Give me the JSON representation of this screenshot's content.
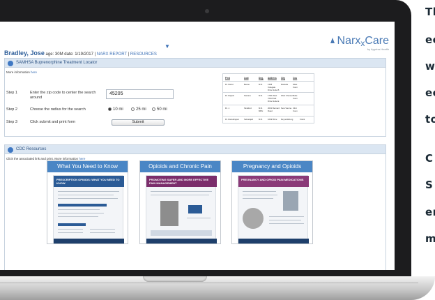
{
  "header": {
    "brand_pre": "Narx",
    "brand_sub": "Care",
    "brand_tagline": "by Appriss Health",
    "patient_name": "Bradley, Jose",
    "age_label": "age: 30M",
    "date_label": "date: 1/19/2017",
    "separator": "|",
    "narx_report_link": "NARX REPORT",
    "resources_link": "RESOURCES"
  },
  "samhsa": {
    "title": "SAMHSA Buprenorphine Treatment Locator",
    "more_info_prefix": "More information",
    "more_info_link": "here",
    "step1_label": "Step 1",
    "step1_text": "Enter the zip code to center the search around",
    "zip_value": "45205",
    "step2_label": "Step 2",
    "step2_text": "Choose the radius for the search",
    "radius_options": [
      "10 mi",
      "25 mi",
      "50 mi"
    ],
    "radius_selected": "10 mi",
    "step3_label": "Step 3",
    "step3_text": "Click submit and print form",
    "submit_label": "Submit"
  },
  "locator_table": {
    "headers": [
      "First",
      "Last",
      "Deg.",
      "Address",
      "City",
      "Cou"
    ],
    "rows": [
      [
        "Dr. David",
        "Beane",
        "M.D.",
        "1338 Colegate Drive Suite B",
        "Marietta",
        "Wast Coun"
      ],
      [
        "Dr. Rajesh",
        "Kanana",
        "M.D.",
        "1760 West VOA Park Drive Suite E",
        "West Chester",
        "Butle Coun"
      ],
      [
        "Dr. J.",
        "Stratford",
        "M.D. MPH",
        "2001 Bernard Road",
        "New Vienna",
        "Clint Coun"
      ],
      [
        "Dr. Ramalingam",
        "Selvarajah",
        "M.D.",
        "1649 Brice",
        "Reynoldsburg",
        "Frank"
      ]
    ]
  },
  "cdc": {
    "title": "CDC Resources",
    "instruction": "Click the associated link and print. More information",
    "more_info_link": "here",
    "cards": [
      {
        "title": "What You Need to Know",
        "poster": "PRESCRIPTION OPIOIDS: WHAT YOU NEED TO KNOW"
      },
      {
        "title": "Opioids and Chronic Pain",
        "poster": "PROMOTING SAFER AND MORE EFFECTIVE PAIN MANAGEMENT"
      },
      {
        "title": "Pregnancy and Opioids",
        "poster": "PREGNANCY AND OPIOID PAIN MEDICATIONS"
      }
    ],
    "poster_note": "PRESCRIPTION OPIOID OVERDOSE IS AN EPIDEMIC IN THE US"
  },
  "side_text": {
    "lines": [
      "Th",
      "ec",
      "wi",
      "ec",
      "to",
      "C",
      "S",
      "er",
      "m"
    ]
  },
  "colors": {
    "accent": "#4a86c5",
    "link": "#3a6fb5",
    "panel_header": "#dbe6f2"
  }
}
